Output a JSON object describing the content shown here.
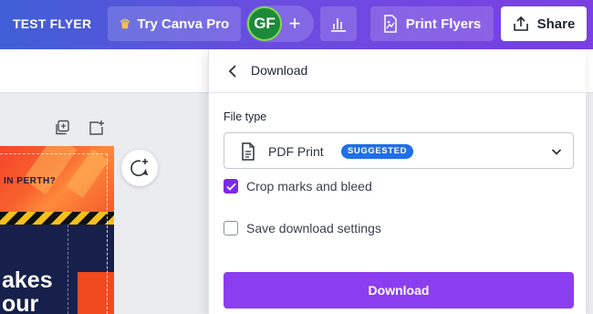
{
  "header": {
    "doc_title": "TEST FLYER",
    "pro_label": "Try Canva Pro",
    "avatar_initials": "GF",
    "add_symbol": "+",
    "print_label": "Print Flyers",
    "share_label": "Share"
  },
  "canvas": {
    "tagline": "IN PERTH?",
    "headline_line1": "akes",
    "headline_line2": "our"
  },
  "download_panel": {
    "title": "Download",
    "file_type_label": "File type",
    "file_type_value": "PDF Print",
    "badge": "SUGGESTED",
    "crop_marks_label": "Crop marks and bleed",
    "crop_marks_checked": true,
    "save_settings_label": "Save download settings",
    "save_settings_checked": false,
    "download_button": "Download"
  },
  "colors": {
    "accent": "#8b3df0",
    "badge": "#1f6fe8",
    "checkbox_checked": "#7d2ae8"
  },
  "icons": [
    "crown-icon",
    "plus-icon",
    "bar-chart-icon",
    "print-flyer-icon",
    "share-upload-icon",
    "duplicate-page-icon",
    "add-page-icon",
    "add-comment-icon",
    "back-arrow-icon",
    "file-icon",
    "chevron-down-icon",
    "checkmark-icon"
  ]
}
